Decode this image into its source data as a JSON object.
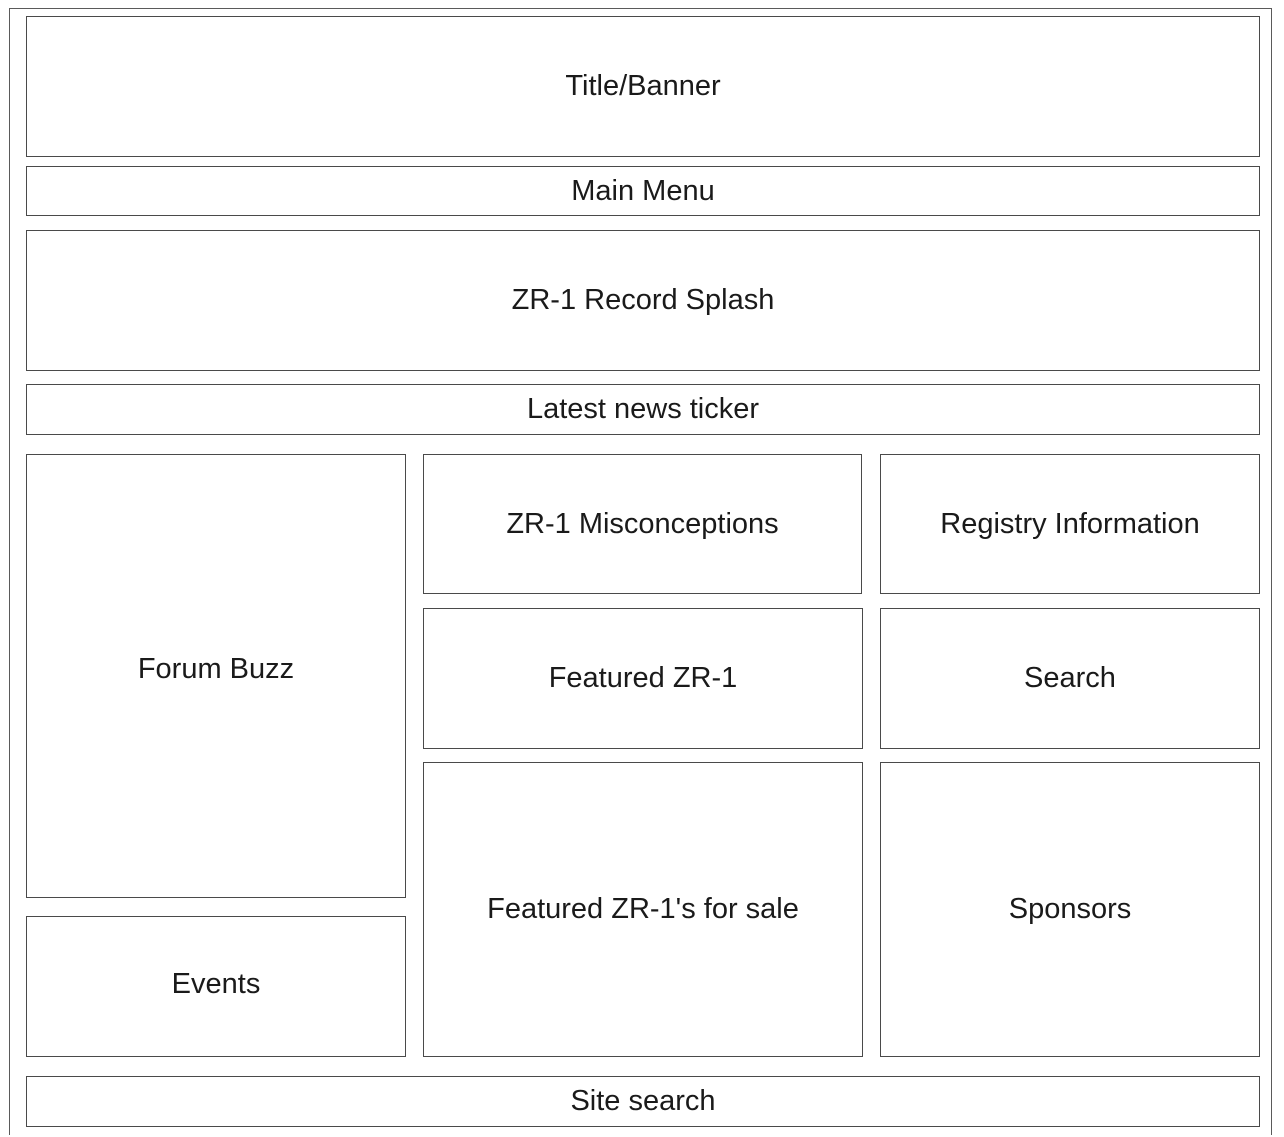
{
  "boxes": {
    "title_banner": "Title/Banner",
    "main_menu": "Main Menu",
    "record_splash": "ZR-1 Record Splash",
    "news_ticker": "Latest news ticker",
    "forum_buzz": "Forum Buzz",
    "events": "Events",
    "misconceptions": "ZR-1 Misconceptions",
    "featured_zr1": "Featured ZR-1",
    "featured_for_sale": "Featured ZR-1's for sale",
    "registry_information": "Registry Information",
    "search": "Search",
    "sponsors": "Sponsors",
    "site_search": "Site search"
  }
}
